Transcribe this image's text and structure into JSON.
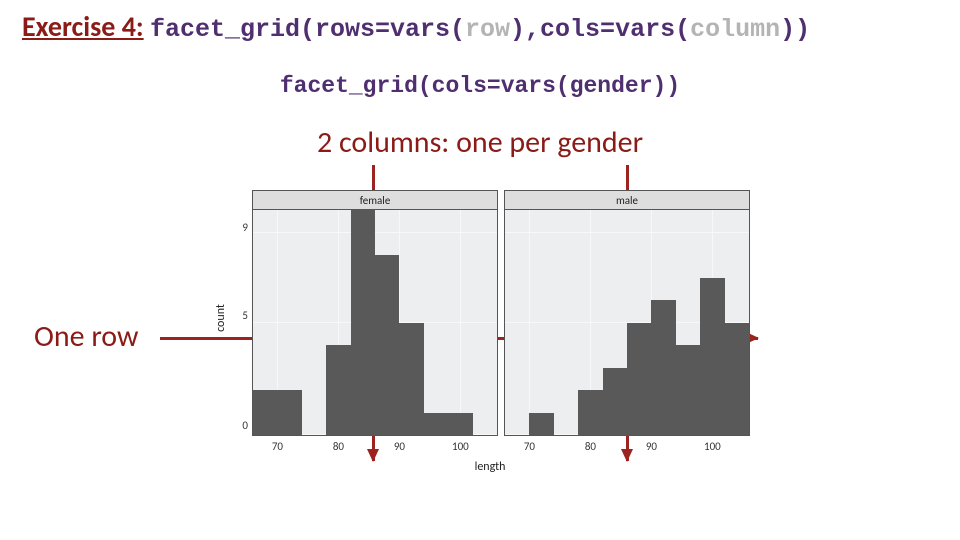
{
  "title": {
    "prefix": "Exercise 4:",
    "code_full": "facet_grid(rows=vars(row),cols=vars(column))"
  },
  "subcode": "facet_grid(cols=vars(gender))",
  "caption": "2 columns: one per gender",
  "one_row_label": "One row",
  "axis": {
    "xlab": "length",
    "ylab": "count",
    "x_ticks": [
      "70",
      "80",
      "90",
      "100"
    ],
    "y_ticks": [
      "0",
      "5",
      "9"
    ]
  },
  "facets": {
    "left_label": "female",
    "right_label": "male"
  },
  "chart_data": {
    "type": "bar",
    "xlabel": "length",
    "ylabel": "count",
    "x_range": [
      66,
      106
    ],
    "ylim": [
      0,
      10
    ],
    "bin_width": 4,
    "series": [
      {
        "name": "female",
        "bins": [
          {
            "x0": 66,
            "x1": 70,
            "count": 2
          },
          {
            "x0": 70,
            "x1": 74,
            "count": 2
          },
          {
            "x0": 74,
            "x1": 78,
            "count": 0
          },
          {
            "x0": 78,
            "x1": 82,
            "count": 4
          },
          {
            "x0": 82,
            "x1": 86,
            "count": 10
          },
          {
            "x0": 86,
            "x1": 90,
            "count": 8
          },
          {
            "x0": 90,
            "x1": 94,
            "count": 5
          },
          {
            "x0": 94,
            "x1": 98,
            "count": 1
          },
          {
            "x0": 98,
            "x1": 102,
            "count": 1
          },
          {
            "x0": 102,
            "x1": 106,
            "count": 0
          }
        ]
      },
      {
        "name": "male",
        "bins": [
          {
            "x0": 66,
            "x1": 70,
            "count": 0
          },
          {
            "x0": 70,
            "x1": 74,
            "count": 1
          },
          {
            "x0": 74,
            "x1": 78,
            "count": 0
          },
          {
            "x0": 78,
            "x1": 82,
            "count": 2
          },
          {
            "x0": 82,
            "x1": 86,
            "count": 3
          },
          {
            "x0": 86,
            "x1": 90,
            "count": 5
          },
          {
            "x0": 90,
            "x1": 94,
            "count": 6
          },
          {
            "x0": 94,
            "x1": 98,
            "count": 4
          },
          {
            "x0": 98,
            "x1": 102,
            "count": 7
          },
          {
            "x0": 102,
            "x1": 106,
            "count": 5
          }
        ]
      }
    ]
  },
  "colors": {
    "accent": "#8a1b17",
    "arrow": "#9b2320",
    "bar": "#595959",
    "panel_bg": "#edeef0",
    "strip_bg": "#dedede"
  }
}
